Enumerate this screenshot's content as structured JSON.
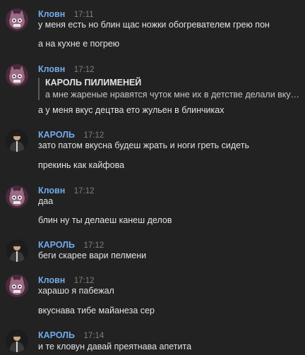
{
  "messages": [
    {
      "author": "Кловн",
      "time": "17:11",
      "avatar": "cat-avatar",
      "lines": [
        "у меня есть но блин щас ножки обогревателем грею пон",
        "а на кухне е погрею"
      ]
    },
    {
      "author": "Кловн",
      "time": "17:12",
      "avatar": "cat-avatar",
      "reply": {
        "author": "КАРОЛЬ ПИЛИМЕНЕЙ",
        "text": "а мне жареные нравятся чуток мне их в детстве делали вкус де..."
      },
      "lines": [
        "а у меня вкус децтва ето жульен в блинчиках"
      ]
    },
    {
      "author": "КАРОЛЬ",
      "time": "17:12",
      "avatar": "person-avatar",
      "lines": [
        "зато патом вкусна будеш жрать и ноги греть сидеть",
        "прекинь как кайфова"
      ]
    },
    {
      "author": "Кловн",
      "time": "17:12",
      "avatar": "cat-avatar",
      "lines": [
        "даа",
        "блин ну ты делаеш канеш делов"
      ]
    },
    {
      "author": "КАРОЛЬ",
      "time": "17:12",
      "avatar": "person-avatar",
      "lines": [
        "беги скарее вари пелмени"
      ]
    },
    {
      "author": "Кловн",
      "time": "17:12",
      "avatar": "cat-avatar",
      "lines": [
        "харашо я пабежал",
        "вкуснава тибе майанеза сер"
      ]
    },
    {
      "author": "КАРОЛЬ",
      "time": "17:14",
      "avatar": "person-avatar",
      "lines": [
        "и те кловун давай преятнава апетита"
      ]
    }
  ],
  "colors": {
    "background": "#222222",
    "author": "#71aaeb",
    "time": "#7d7f82",
    "text": "#e1e3e6"
  }
}
